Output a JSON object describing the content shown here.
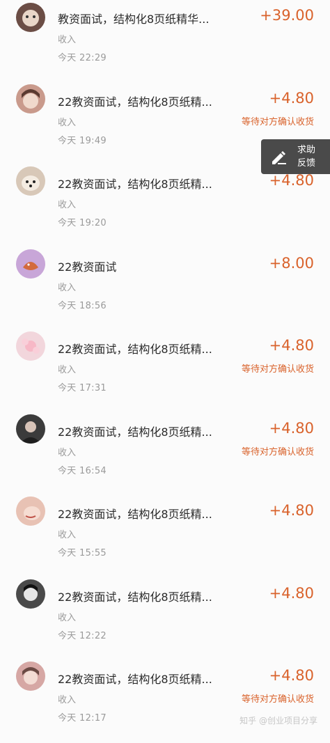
{
  "feedback": {
    "line1": "求助",
    "line2": "反馈",
    "icon": "edit-pencil-icon"
  },
  "transactions": [
    {
      "title": "教资面试，结构化8页纸精华...",
      "type": "收入",
      "time": "今天  22:29",
      "amount": "+39.00",
      "status": "",
      "avatar_color": "#6b4d45"
    },
    {
      "title": "22教资面试，结构化8页纸精...",
      "type": "收入",
      "time": "今天  19:49",
      "amount": "+4.80",
      "status": "等待对方确认收货",
      "avatar_color": "#c99a8c"
    },
    {
      "title": "22教资面试，结构化8页纸精...",
      "type": "收入",
      "time": "今天  19:20",
      "amount": "+4.80",
      "status": "",
      "avatar_color": "#d8c8b8"
    },
    {
      "title": "22教资面试",
      "type": "收入",
      "time": "今天  18:56",
      "amount": "+8.00",
      "status": "",
      "avatar_color": "#c8a6d8"
    },
    {
      "title": "22教资面试，结构化8页纸精...",
      "type": "收入",
      "time": "今天  17:31",
      "amount": "+4.80",
      "status": "等待对方确认收货",
      "avatar_color": "#f2d6dc"
    },
    {
      "title": "22教资面试，结构化8页纸精...",
      "type": "收入",
      "time": "今天  16:54",
      "amount": "+4.80",
      "status": "等待对方确认收货",
      "avatar_color": "#3b3b3b"
    },
    {
      "title": "22教资面试，结构化8页纸精...",
      "type": "收入",
      "time": "今天  15:55",
      "amount": "+4.80",
      "status": "",
      "avatar_color": "#e8c2b4"
    },
    {
      "title": "22教资面试，结构化8页纸精...",
      "type": "收入",
      "time": "今天  12:22",
      "amount": "+4.80",
      "status": "",
      "avatar_color": "#4a4a4a"
    },
    {
      "title": "22教资面试，结构化8页纸精...",
      "type": "收入",
      "time": "今天  12:17",
      "amount": "+4.80",
      "status": "等待对方确认收货",
      "avatar_color": "#d6a7a4"
    }
  ],
  "watermark": "知乎 @创业项目分享",
  "colors": {
    "accent": "#d9622b",
    "muted": "#9a9a9a"
  }
}
